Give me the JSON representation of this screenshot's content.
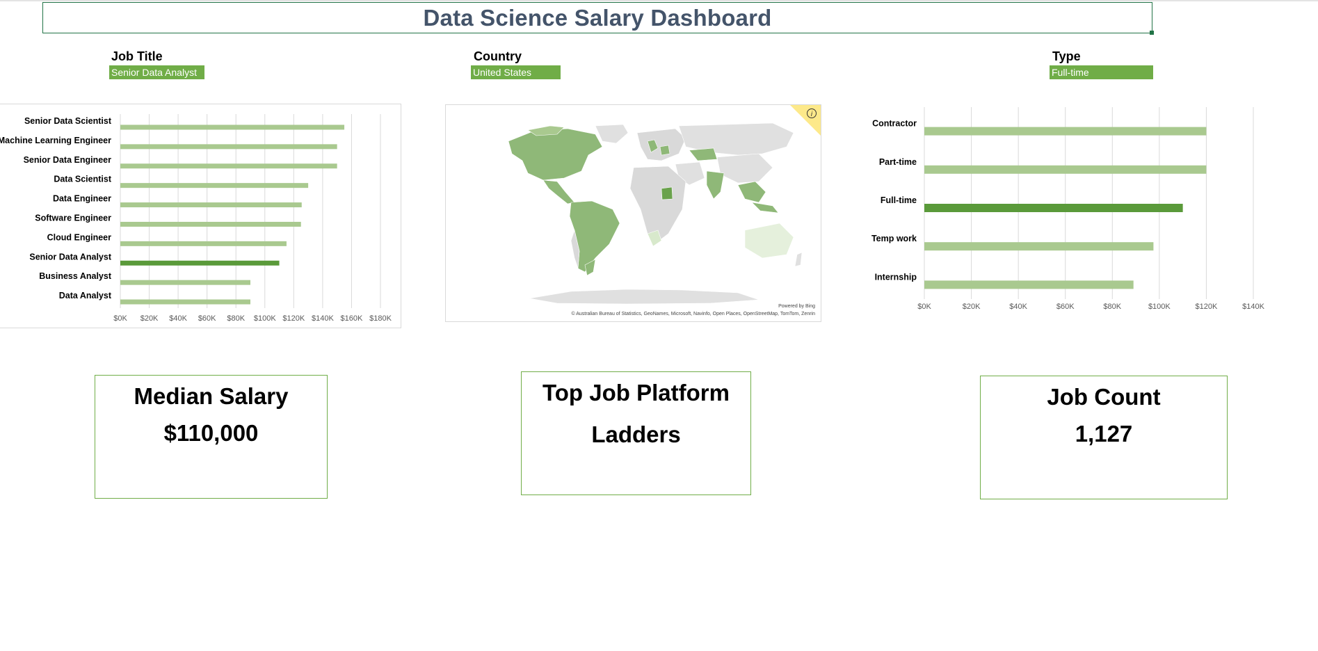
{
  "dashboard": {
    "title": "Data Science Salary Dashboard"
  },
  "filters": {
    "job_title": {
      "label": "Job Title",
      "value": "Senior Data Analyst"
    },
    "country": {
      "label": "Country",
      "value": "United States"
    },
    "type": {
      "label": "Type",
      "value": "Full-time"
    }
  },
  "map": {
    "info_icon": "info-icon",
    "powered_by": "Powered by Bing",
    "attribution": "© Australian Bureau of Statistics, GeoNames, Microsoft, Navinfo, Open Places, OpenStreetMap, TomTom, Zenrin"
  },
  "kpis": {
    "median_salary": {
      "title": "Median Salary",
      "value": "$110,000"
    },
    "top_platform": {
      "title": "Top Job Platform",
      "value": "Ladders"
    },
    "job_count": {
      "title": "Job Count",
      "value": "1,127"
    }
  },
  "colors": {
    "accent": "#70ad47",
    "bar_light": "#a9c98f",
    "bar_highlight": "#5a9a3a",
    "title_text": "#44546a",
    "gridline": "#d9d9d9"
  },
  "chart_data": [
    {
      "type": "bar",
      "orientation": "horizontal",
      "categories": [
        "Senior Data Scientist",
        "Machine Learning Engineer",
        "Senior Data Engineer",
        "Data Scientist",
        "Data Engineer",
        "Software Engineer",
        "Cloud Engineer",
        "Senior Data Analyst",
        "Business Analyst",
        "Data Analyst"
      ],
      "values": [
        155000,
        150000,
        150000,
        130000,
        125500,
        125000,
        115000,
        110000,
        90000,
        90000
      ],
      "highlight": "Senior Data Analyst",
      "xlim": [
        0,
        180000
      ],
      "x_ticks": [
        "$0K",
        "$20K",
        "$40K",
        "$60K",
        "$80K",
        "$100K",
        "$120K",
        "$140K",
        "$160K",
        "$180K"
      ],
      "grid": true,
      "legend": "none"
    },
    {
      "type": "bar",
      "orientation": "horizontal",
      "categories": [
        "Contractor",
        "Part-time",
        "Full-time",
        "Temp work",
        "Internship"
      ],
      "values": [
        120000,
        120000,
        110000,
        97500,
        89000
      ],
      "highlight": "Full-time",
      "xlim": [
        0,
        140000
      ],
      "x_ticks": [
        "$0K",
        "$20K",
        "$40K",
        "$60K",
        "$80K",
        "$100K",
        "$120K",
        "$140K"
      ],
      "grid": true,
      "legend": "none"
    }
  ]
}
